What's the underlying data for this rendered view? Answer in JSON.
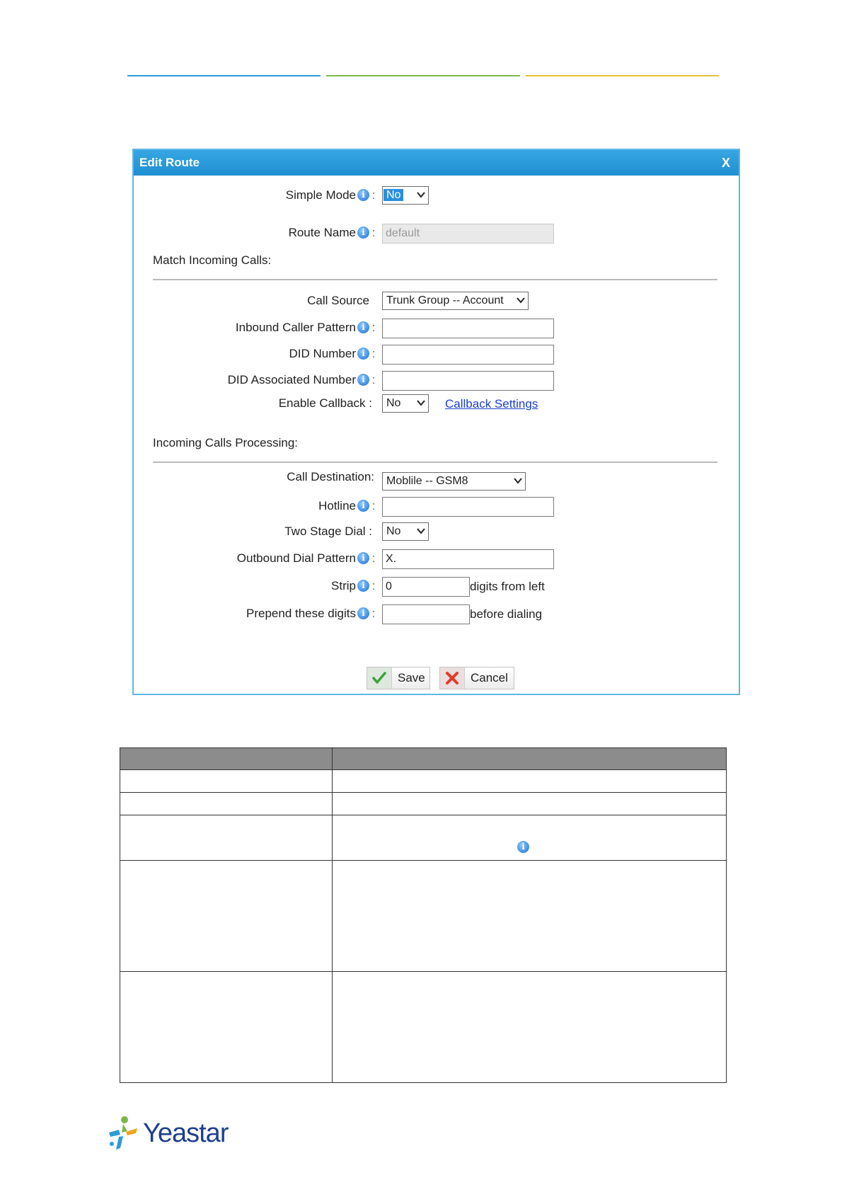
{
  "dialog": {
    "title": "Edit Route",
    "close_label": "X",
    "simple_mode": {
      "label": "Simple Mode",
      "value": "No"
    },
    "route_name": {
      "label": "Route Name",
      "value": "default"
    },
    "match_section": "Match Incoming Calls:",
    "call_source": {
      "label": "Call Source",
      "value": "Trunk Group -- Account"
    },
    "inbound_caller_pattern": {
      "label": "Inbound Caller Pattern",
      "value": ""
    },
    "did_number": {
      "label": "DID Number",
      "value": ""
    },
    "did_associated_number": {
      "label": "DID Associated Number",
      "value": ""
    },
    "enable_callback": {
      "label": "Enable Callback :",
      "value": "No"
    },
    "callback_settings_link": "Callback Settings",
    "processing_section": "Incoming Calls Processing:",
    "call_destination": {
      "label": "Call Destination:",
      "value": "Moblile -- GSM8"
    },
    "hotline": {
      "label": "Hotline",
      "value": ""
    },
    "two_stage_dial": {
      "label": "Two Stage Dial :",
      "value": "No"
    },
    "outbound_dial_pattern": {
      "label": "Outbound Dial Pattern",
      "value": "X."
    },
    "strip": {
      "label": "Strip",
      "value": "0",
      "suffix": "digits from left"
    },
    "prepend": {
      "label": "Prepend these digits",
      "value": "",
      "suffix": "before dialing"
    },
    "save_label": "Save",
    "cancel_label": "Cancel"
  },
  "colors": {
    "titlebar": "#1f8fd1",
    "line_blue": "#2f9bd6",
    "line_green": "#7ab648",
    "line_yellow": "#e2c23b",
    "link": "#1a3fcf"
  },
  "footer": {
    "logo_text": "Yeastar"
  }
}
